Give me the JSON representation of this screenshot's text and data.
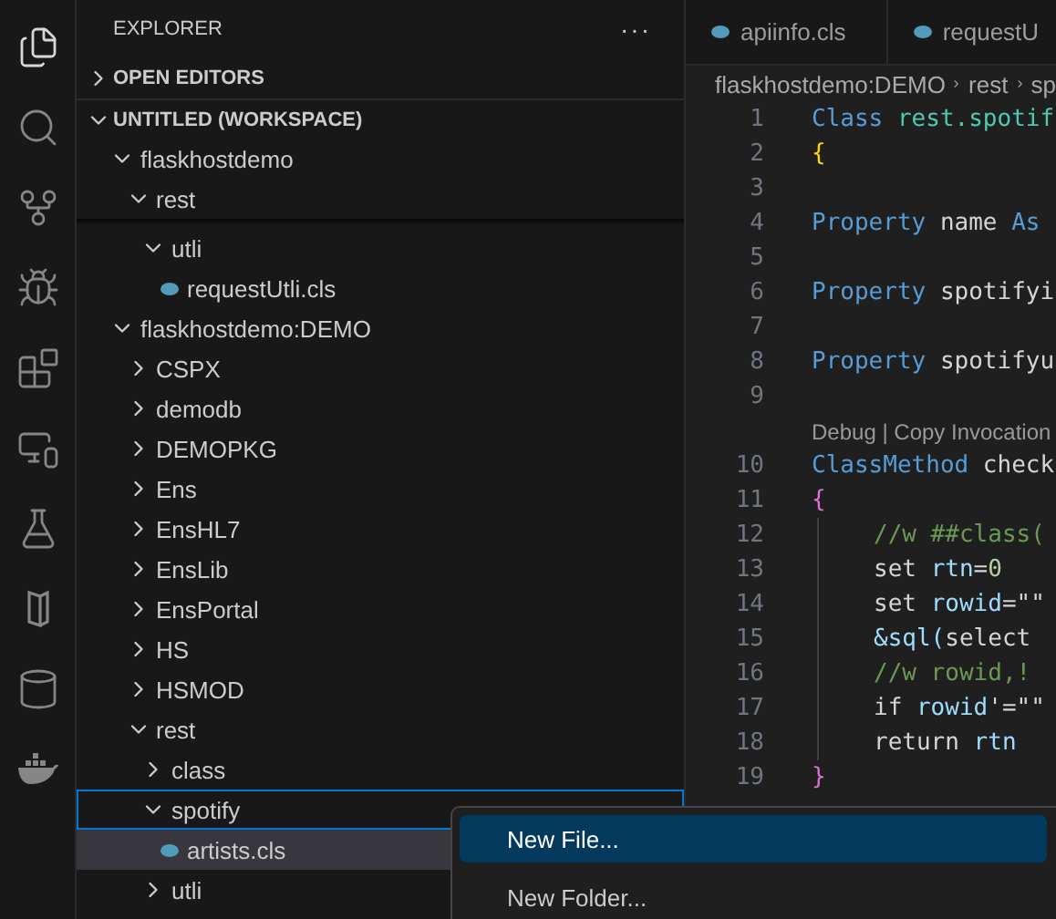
{
  "activity_bar": [
    {
      "kind": "files",
      "selected": true
    },
    {
      "kind": "search",
      "selected": false
    },
    {
      "kind": "source-control",
      "selected": false
    },
    {
      "kind": "run-debug",
      "selected": false
    },
    {
      "kind": "extensions",
      "selected": false
    },
    {
      "kind": "remote",
      "selected": false
    },
    {
      "kind": "testing",
      "selected": false
    },
    {
      "kind": "book",
      "selected": false
    },
    {
      "kind": "database",
      "selected": false
    },
    {
      "kind": "docker",
      "selected": false
    }
  ],
  "sidebar": {
    "title": "EXPLORER",
    "more": "···",
    "sections": [
      {
        "label": "OPEN EDITORS",
        "expanded": false
      },
      {
        "label": "UNTITLED (WORKSPACE)",
        "expanded": true
      }
    ],
    "tree": [
      {
        "label": "flaskhostdemo",
        "kind": "folder",
        "expanded": true,
        "selected": false,
        "focused": false,
        "children": [
          {
            "label": "rest",
            "kind": "folder",
            "expanded": true,
            "selected": false,
            "focused": false,
            "children": [
              {
                "label": "utli",
                "kind": "folder",
                "expanded": true,
                "selected": false,
                "focused": false,
                "children": [
                  {
                    "label": "requestUtli.cls",
                    "kind": "file",
                    "selected": false,
                    "focused": false
                  }
                ]
              }
            ]
          }
        ]
      },
      {
        "label": "flaskhostdemo:DEMO",
        "kind": "folder",
        "expanded": true,
        "selected": false,
        "focused": false,
        "children": [
          {
            "label": "CSPX",
            "kind": "folder",
            "expanded": false,
            "selected": false,
            "focused": false
          },
          {
            "label": "demodb",
            "kind": "folder",
            "expanded": false,
            "selected": false,
            "focused": false
          },
          {
            "label": "DEMOPKG",
            "kind": "folder",
            "expanded": false,
            "selected": false,
            "focused": false
          },
          {
            "label": "Ens",
            "kind": "folder",
            "expanded": false,
            "selected": false,
            "focused": false
          },
          {
            "label": "EnsHL7",
            "kind": "folder",
            "expanded": false,
            "selected": false,
            "focused": false
          },
          {
            "label": "EnsLib",
            "kind": "folder",
            "expanded": false,
            "selected": false,
            "focused": false
          },
          {
            "label": "EnsPortal",
            "kind": "folder",
            "expanded": false,
            "selected": false,
            "focused": false
          },
          {
            "label": "HS",
            "kind": "folder",
            "expanded": false,
            "selected": false,
            "focused": false
          },
          {
            "label": "HSMOD",
            "kind": "folder",
            "expanded": false,
            "selected": false,
            "focused": false
          },
          {
            "label": "rest",
            "kind": "folder",
            "expanded": true,
            "selected": false,
            "focused": false,
            "children": [
              {
                "label": "class",
                "kind": "folder",
                "expanded": false,
                "selected": false,
                "focused": false
              },
              {
                "label": "spotify",
                "kind": "folder",
                "expanded": true,
                "selected": false,
                "focused": true,
                "children": [
                  {
                    "label": "artists.cls",
                    "kind": "file",
                    "selected": true,
                    "focused": false
                  }
                ]
              },
              {
                "label": "utli",
                "kind": "folder",
                "expanded": false,
                "selected": false,
                "focused": false
              }
            ]
          }
        ]
      }
    ]
  },
  "editor": {
    "tabs": [
      {
        "label": "apiinfo.cls"
      },
      {
        "label": "requestU"
      }
    ],
    "breadcrumb": [
      "flaskhostdemo:DEMO",
      "rest",
      "sp"
    ],
    "lines": [
      {
        "number": "1",
        "tokens": [
          {
            "kind": "kw",
            "text": "Class "
          },
          {
            "kind": "cls",
            "text": "rest.spotif"
          }
        ]
      },
      {
        "number": "2",
        "tokens": [
          {
            "kind": "brace1",
            "text": "{"
          }
        ]
      },
      {
        "number": "3"
      },
      {
        "number": "4",
        "tokens": [
          {
            "kind": "kw",
            "text": "Property "
          },
          {
            "kind": "plain",
            "text": "name "
          },
          {
            "kind": "kw",
            "text": "As"
          }
        ]
      },
      {
        "number": "5"
      },
      {
        "number": "6",
        "tokens": [
          {
            "kind": "kw",
            "text": "Property "
          },
          {
            "kind": "plain",
            "text": "spotifyi"
          }
        ]
      },
      {
        "number": "7"
      },
      {
        "number": "8",
        "tokens": [
          {
            "kind": "kw",
            "text": "Property "
          },
          {
            "kind": "plain",
            "text": "spotifyu"
          }
        ]
      },
      {
        "number": "9"
      },
      {
        "kind": "codelens",
        "text": "Debug | Copy Invocation"
      },
      {
        "number": "10",
        "tokens": [
          {
            "kind": "kw",
            "text": "ClassMethod "
          },
          {
            "kind": "plain",
            "text": "check"
          }
        ]
      },
      {
        "number": "11",
        "tokens": [
          {
            "kind": "brace2",
            "text": "{"
          }
        ]
      },
      {
        "number": "12",
        "indent": true,
        "tokens": [
          {
            "kind": "comment",
            "text": "//w ##class("
          }
        ]
      },
      {
        "number": "13",
        "indent": true,
        "tokens": [
          {
            "kind": "plain",
            "text": "set "
          },
          {
            "kind": "var",
            "text": "rtn"
          },
          {
            "kind": "plain",
            "text": "="
          },
          {
            "kind": "num",
            "text": "0"
          }
        ]
      },
      {
        "number": "14",
        "indent": true,
        "tokens": [
          {
            "kind": "plain",
            "text": "set "
          },
          {
            "kind": "var",
            "text": "rowid"
          },
          {
            "kind": "plain",
            "text": "=\"\""
          }
        ]
      },
      {
        "number": "15",
        "indent": true,
        "tokens": [
          {
            "kind": "var",
            "text": "&sql("
          },
          {
            "kind": "plain",
            "text": "select"
          }
        ]
      },
      {
        "number": "16",
        "indent": true,
        "tokens": [
          {
            "kind": "comment",
            "text": "//w rowid,!"
          }
        ]
      },
      {
        "number": "17",
        "indent": true,
        "tokens": [
          {
            "kind": "plain",
            "text": "if "
          },
          {
            "kind": "var",
            "text": "rowid"
          },
          {
            "kind": "plain",
            "text": "'=\"\""
          }
        ]
      },
      {
        "number": "18",
        "indent": true,
        "tokens": [
          {
            "kind": "plain",
            "text": "return "
          },
          {
            "kind": "var",
            "text": "rtn"
          }
        ]
      },
      {
        "number": "19",
        "tokens": [
          {
            "kind": "brace2",
            "text": "}"
          }
        ]
      }
    ]
  },
  "context_menu": {
    "items": [
      {
        "label": "New File...",
        "selected": true
      },
      {
        "label": "New Folder...",
        "selected": false
      }
    ]
  }
}
